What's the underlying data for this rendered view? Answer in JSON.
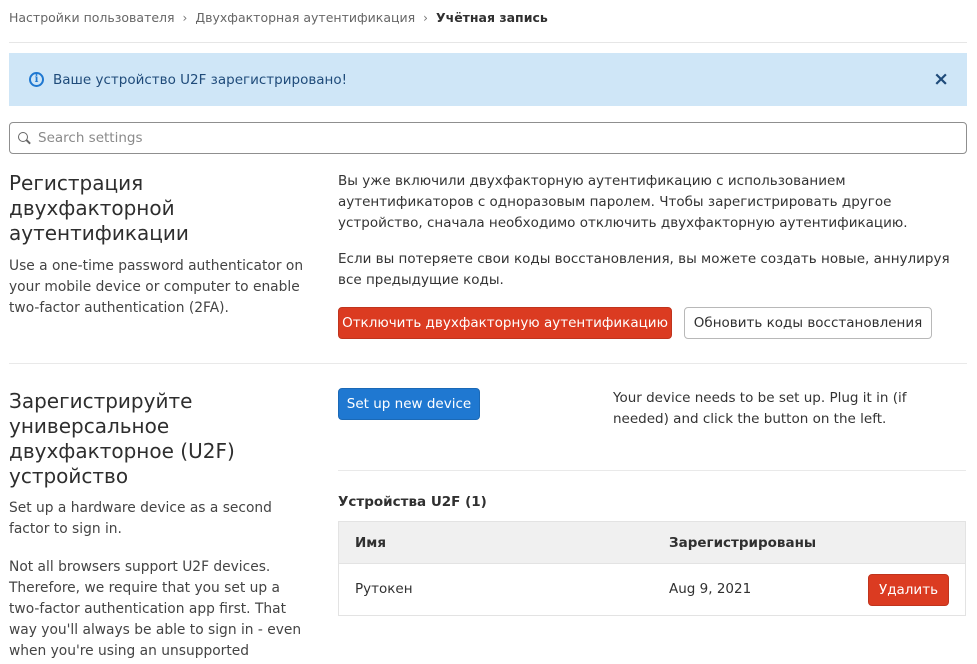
{
  "breadcrumb": {
    "items": [
      "Настройки пользователя",
      "Двухфакторная аутентификация"
    ],
    "current": "Учётная запись",
    "separator": "›"
  },
  "alert": {
    "icon": "info-icon",
    "message": "Ваше устройство U2F зарегистрировано!",
    "close_symbol": "×"
  },
  "search": {
    "placeholder": "Search settings",
    "value": ""
  },
  "section_2fa": {
    "title": "Регистрация двухфакторной аутентификации",
    "description": "Use a one-time password authenticator on your mobile device or computer to enable two-factor authentication (2FA).",
    "paragraph1": "Вы уже включили двухфакторную аутентификацию с использованием аутентификаторов с одноразовым паролем. Чтобы зарегистрировать другое устройство, сначала необходимо отключить двухфакторную аутентификацию.",
    "paragraph2": "Если вы потеряете свои коды восстановления, вы можете создать новые, аннулируя все предыдущие коды.",
    "disable_button": "Отключить двухфакторную аутентификацию",
    "regenerate_button": "Обновить коды восстановления"
  },
  "section_u2f": {
    "title": "Зарегистрируйте универсальное двухфакторное (U2F) устройство",
    "description1": "Set up a hardware device as a second factor to sign in.",
    "description2": "Not all browsers support U2F devices. Therefore, we require that you set up a two-factor authentication app first. That way you'll always be able to sign in - even when you're using an unsupported browser.",
    "setup_button": "Set up new device",
    "setup_hint": "Your device needs to be set up. Plug it in (if needed) and click the button on the left.",
    "devices_title": "Устройства U2F (1)",
    "table": {
      "columns": [
        "Имя",
        "Зарегистрированы"
      ],
      "rows": [
        {
          "name": "Рутокен",
          "registered": "Aug 9, 2021",
          "action": "Удалить"
        }
      ]
    }
  },
  "colors": {
    "danger": "#db3b21",
    "primary": "#1f78d1",
    "alert_bg": "#cfe6f7"
  }
}
